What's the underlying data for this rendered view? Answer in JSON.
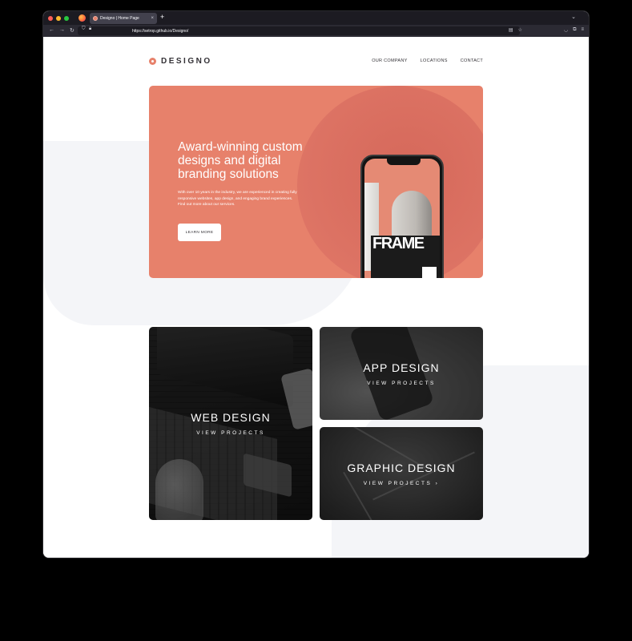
{
  "browser": {
    "tab_title": "Designo | Home Page",
    "tab_close": "×",
    "new_tab": "+",
    "tab_list": "⌄",
    "back": "←",
    "forward": "→",
    "reload": "↻",
    "url": "https://setrop.github.io/Designo/"
  },
  "site": {
    "logo_text": "DESIGNO",
    "nav": [
      "OUR COMPANY",
      "LOCATIONS",
      "CONTACT"
    ]
  },
  "hero": {
    "title": "Award-winning custom designs and digital branding solutions",
    "body": "With over 10 years in the industry, we are experienced in creating fully responsive websites, app design, and engaging brand experiences. Find out more about our services.",
    "button": "LEARN MORE",
    "phone_text": "FRAME",
    "accent": "#e7816b"
  },
  "cards": [
    {
      "title": "WEB DESIGN",
      "cta": "VIEW PROJECTS"
    },
    {
      "title": "APP DESIGN",
      "cta": "VIEW PROJECTS"
    },
    {
      "title": "GRAPHIC DESIGN",
      "cta": "VIEW PROJECTS ›"
    }
  ]
}
